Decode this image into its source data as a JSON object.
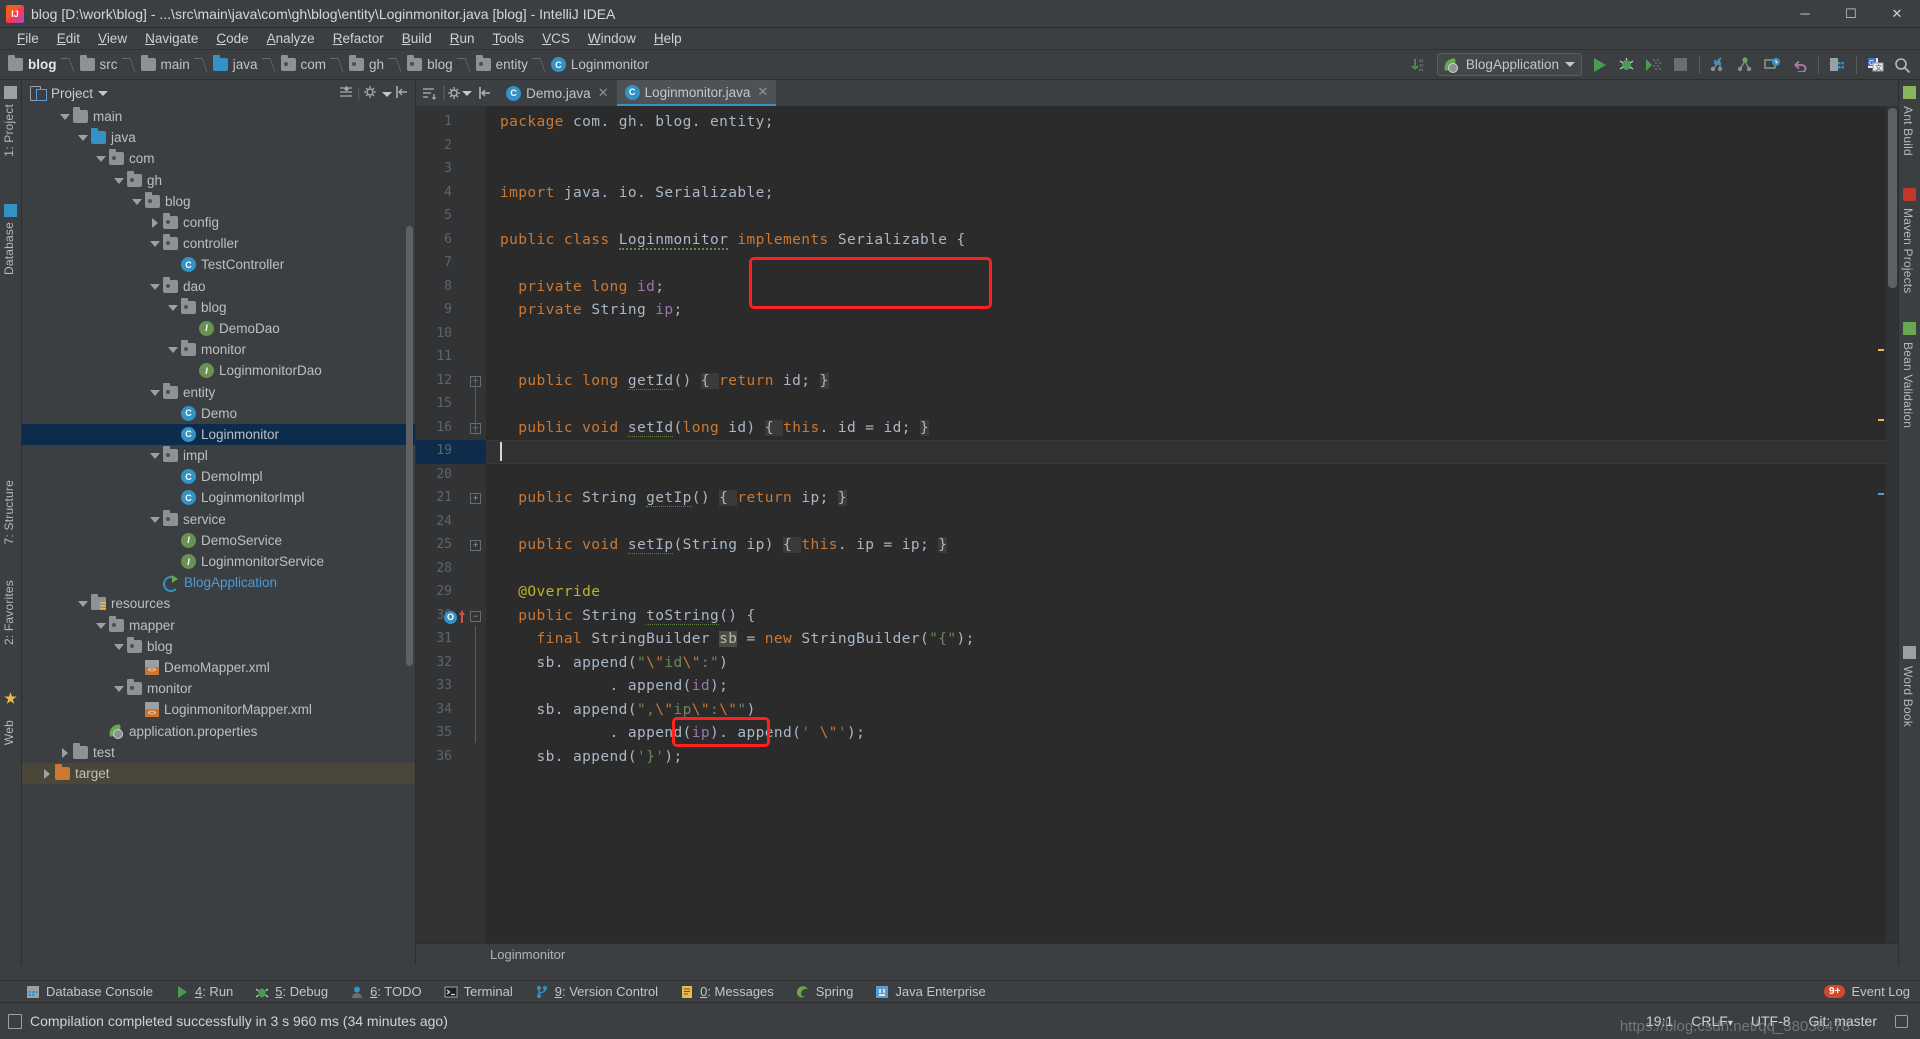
{
  "window": {
    "title": "blog [D:\\work\\blog] - ...\\src\\main\\java\\com\\gh\\blog\\entity\\Loginmonitor.java [blog] - IntelliJ IDEA",
    "app_icon": "intellij-idea-icon",
    "minimize": "─",
    "maximize": "☐",
    "close": "✕"
  },
  "menu": {
    "items": [
      "File",
      "Edit",
      "View",
      "Navigate",
      "Code",
      "Analyze",
      "Refactor",
      "Build",
      "Run",
      "Tools",
      "VCS",
      "Window",
      "Help"
    ]
  },
  "navbar": {
    "breadcrumbs": [
      {
        "label": "blog",
        "icon": "module-folder-icon"
      },
      {
        "label": "src",
        "icon": "folder-icon"
      },
      {
        "label": "main",
        "icon": "folder-icon"
      },
      {
        "label": "java",
        "icon": "source-root-folder-icon"
      },
      {
        "label": "com",
        "icon": "package-folder-icon"
      },
      {
        "label": "gh",
        "icon": "package-folder-icon"
      },
      {
        "label": "blog",
        "icon": "package-folder-icon"
      },
      {
        "label": "entity",
        "icon": "package-folder-icon"
      },
      {
        "label": "Loginmonitor",
        "icon": "java-class-icon"
      }
    ],
    "run_config": "BlogApplication",
    "toolbar_icons": [
      "download-updates-icon",
      "run-icon",
      "debug-icon",
      "run-coverage-icon",
      "stop-icon",
      "attach-icon",
      "profiler-icon",
      "db-time-icon",
      "undo-icon",
      "build-icon",
      "translate-icon",
      "search-icon"
    ]
  },
  "left_strip": {
    "tabs": [
      {
        "label": "1: Project",
        "icon": "project-tool-icon"
      },
      {
        "label": "Database",
        "icon": "database-tool-icon"
      },
      {
        "label": "7: Structure",
        "icon": "structure-tool-icon"
      },
      {
        "label": "2: Favorites",
        "icon": "favorites-tool-icon"
      },
      {
        "label": "Web",
        "icon": "web-tool-icon"
      }
    ]
  },
  "right_strip": {
    "tabs": [
      {
        "label": "Ant Build",
        "icon": "ant-icon"
      },
      {
        "label": "Maven Projects",
        "icon": "maven-icon"
      },
      {
        "label": "Bean Validation",
        "icon": "bean-icon"
      },
      {
        "label": "Word Book",
        "icon": "wordbook-icon"
      }
    ]
  },
  "project_panel": {
    "title": "Project",
    "dropdown_icon": "chevron-down-icon",
    "tools": [
      "collapse-all-icon",
      "settings-icon",
      "hide-icon"
    ],
    "tree": [
      {
        "label": "main",
        "indent": 1,
        "arrow": "down",
        "icon": "folder-icon"
      },
      {
        "label": "java",
        "indent": 2,
        "arrow": "down",
        "icon": "source-root-folder-icon"
      },
      {
        "label": "com",
        "indent": 3,
        "arrow": "down",
        "icon": "package-folder-icon"
      },
      {
        "label": "gh",
        "indent": 4,
        "arrow": "down",
        "icon": "package-folder-icon"
      },
      {
        "label": "blog",
        "indent": 5,
        "arrow": "down",
        "icon": "package-folder-icon"
      },
      {
        "label": "config",
        "indent": 6,
        "arrow": "right",
        "icon": "package-folder-icon"
      },
      {
        "label": "controller",
        "indent": 6,
        "arrow": "down",
        "icon": "package-folder-icon"
      },
      {
        "label": "TestController",
        "indent": 7,
        "arrow": "none",
        "icon": "java-class-icon"
      },
      {
        "label": "dao",
        "indent": 6,
        "arrow": "down",
        "icon": "package-folder-icon"
      },
      {
        "label": "blog",
        "indent": 7,
        "arrow": "down",
        "icon": "package-folder-icon"
      },
      {
        "label": "DemoDao",
        "indent": 8,
        "arrow": "none",
        "icon": "java-interface-icon"
      },
      {
        "label": "monitor",
        "indent": 7,
        "arrow": "down",
        "icon": "package-folder-icon"
      },
      {
        "label": "LoginmonitorDao",
        "indent": 8,
        "arrow": "none",
        "icon": "java-interface-icon"
      },
      {
        "label": "entity",
        "indent": 6,
        "arrow": "down",
        "icon": "package-folder-icon"
      },
      {
        "label": "Demo",
        "indent": 7,
        "arrow": "none",
        "icon": "java-class-icon"
      },
      {
        "label": "Loginmonitor",
        "indent": 7,
        "arrow": "none",
        "icon": "java-class-icon",
        "selected": true
      },
      {
        "label": "impl",
        "indent": 6,
        "arrow": "down",
        "icon": "package-folder-icon"
      },
      {
        "label": "DemoImpl",
        "indent": 7,
        "arrow": "none",
        "icon": "java-class-icon"
      },
      {
        "label": "LoginmonitorImpl",
        "indent": 7,
        "arrow": "none",
        "icon": "java-class-icon"
      },
      {
        "label": "service",
        "indent": 6,
        "arrow": "down",
        "icon": "package-folder-icon"
      },
      {
        "label": "DemoService",
        "indent": 7,
        "arrow": "none",
        "icon": "java-interface-icon"
      },
      {
        "label": "LoginmonitorService",
        "indent": 7,
        "arrow": "none",
        "icon": "java-interface-icon"
      },
      {
        "label": "BlogApplication",
        "indent": 6,
        "arrow": "none",
        "icon": "spring-boot-class-icon",
        "blue": true
      },
      {
        "label": "resources",
        "indent": 2,
        "arrow": "down",
        "icon": "resources-root-folder-icon"
      },
      {
        "label": "mapper",
        "indent": 3,
        "arrow": "down",
        "icon": "package-folder-icon"
      },
      {
        "label": "blog",
        "indent": 4,
        "arrow": "down",
        "icon": "package-folder-icon"
      },
      {
        "label": "DemoMapper.xml",
        "indent": 5,
        "arrow": "none",
        "icon": "xml-file-icon"
      },
      {
        "label": "monitor",
        "indent": 4,
        "arrow": "down",
        "icon": "package-folder-icon"
      },
      {
        "label": "LoginmonitorMapper.xml",
        "indent": 5,
        "arrow": "none",
        "icon": "xml-file-icon"
      },
      {
        "label": "application.properties",
        "indent": 3,
        "arrow": "none",
        "icon": "spring-properties-icon"
      },
      {
        "label": "test",
        "indent": 1,
        "arrow": "right",
        "icon": "folder-icon"
      },
      {
        "label": "target",
        "indent": 0,
        "arrow": "right",
        "icon": "excluded-folder-icon",
        "excluded": true
      }
    ]
  },
  "editor": {
    "tabs": [
      {
        "label": "Demo.java",
        "icon": "java-class-icon",
        "active": false,
        "close": "✕"
      },
      {
        "label": "Loginmonitor.java",
        "icon": "java-class-icon",
        "active": true,
        "close": "✕"
      }
    ],
    "gutter_line_numbers": [
      "1",
      "2",
      "3",
      "4",
      "5",
      "6",
      "7",
      "8",
      "9",
      "10",
      "11",
      "12",
      "15",
      "16",
      "19",
      "20",
      "21",
      "24",
      "25",
      "28",
      "29",
      "30",
      "31",
      "32",
      "33",
      "34",
      "35",
      "36"
    ],
    "current_line": "19",
    "breadcrumb": "Loginmonitor",
    "lines": [
      {
        "n": "1",
        "segments": [
          {
            "t": "package",
            "c": "kw"
          },
          {
            "t": " com. gh. blog. entity;",
            "c": "pl"
          }
        ]
      },
      {
        "n": "2",
        "segments": []
      },
      {
        "n": "3",
        "segments": []
      },
      {
        "n": "4",
        "segments": [
          {
            "t": "import",
            "c": "kw"
          },
          {
            "t": " java. io. Serializable;",
            "c": "pl"
          }
        ]
      },
      {
        "n": "5",
        "segments": []
      },
      {
        "n": "6",
        "segments": [
          {
            "t": "public class ",
            "c": "kw"
          },
          {
            "t": "Loginmonitor",
            "c": "wav"
          },
          {
            "t": " ",
            "c": "pl"
          },
          {
            "t": "implements",
            "c": "kw"
          },
          {
            "t": " Serializable",
            "c": "pl"
          },
          {
            "t": " {",
            "c": "pl"
          }
        ]
      },
      {
        "n": "7",
        "segments": []
      },
      {
        "n": "8",
        "segments": [
          {
            "t": "  private long ",
            "c": "kw"
          },
          {
            "t": "id",
            "c": "fld"
          },
          {
            "t": ";",
            "c": "pl"
          }
        ]
      },
      {
        "n": "9",
        "segments": [
          {
            "t": "  private ",
            "c": "kw"
          },
          {
            "t": "String ",
            "c": "pl"
          },
          {
            "t": "ip",
            "c": "fld"
          },
          {
            "t": ";",
            "c": "pl"
          }
        ]
      },
      {
        "n": "10",
        "segments": []
      },
      {
        "n": "11",
        "segments": []
      },
      {
        "n": "12",
        "segments": [
          {
            "t": "  public long ",
            "c": "kw"
          },
          {
            "t": "getId",
            "c": "mth"
          },
          {
            "t": "() ",
            "c": "pl"
          },
          {
            "t": "{ ",
            "c": "fldbg"
          },
          {
            "t": "return",
            "c": "kw"
          },
          {
            "t": " id; ",
            "c": "pl"
          },
          {
            "t": "}",
            "c": "fldbg"
          }
        ]
      },
      {
        "n": "15",
        "segments": []
      },
      {
        "n": "16",
        "segments": [
          {
            "t": "  public void ",
            "c": "kw"
          },
          {
            "t": "setId",
            "c": "mth"
          },
          {
            "t": "(",
            "c": "pl"
          },
          {
            "t": "long",
            "c": "kw"
          },
          {
            "t": " id) ",
            "c": "pl"
          },
          {
            "t": "{ ",
            "c": "fldbg"
          },
          {
            "t": "this",
            "c": "kw"
          },
          {
            "t": ". id = id; ",
            "c": "pl"
          },
          {
            "t": "}",
            "c": "fldbg"
          }
        ]
      },
      {
        "n": "19",
        "segments": []
      },
      {
        "n": "20",
        "segments": []
      },
      {
        "n": "21",
        "segments": [
          {
            "t": "  public ",
            "c": "kw"
          },
          {
            "t": "String ",
            "c": "pl"
          },
          {
            "t": "getIp",
            "c": "mth"
          },
          {
            "t": "() ",
            "c": "pl"
          },
          {
            "t": "{ ",
            "c": "fldbg"
          },
          {
            "t": "return",
            "c": "kw"
          },
          {
            "t": " ip; ",
            "c": "pl"
          },
          {
            "t": "}",
            "c": "fldbg"
          }
        ]
      },
      {
        "n": "24",
        "segments": []
      },
      {
        "n": "25",
        "segments": [
          {
            "t": "  public void ",
            "c": "kw"
          },
          {
            "t": "setIp",
            "c": "mth"
          },
          {
            "t": "(String ip) ",
            "c": "pl"
          },
          {
            "t": "{ ",
            "c": "fldbg"
          },
          {
            "t": "this",
            "c": "kw"
          },
          {
            "t": ". ip = ip; ",
            "c": "pl"
          },
          {
            "t": "}",
            "c": "fldbg"
          }
        ]
      },
      {
        "n": "28",
        "segments": []
      },
      {
        "n": "29",
        "segments": [
          {
            "t": "  @Override",
            "c": "anno"
          }
        ]
      },
      {
        "n": "30",
        "segments": [
          {
            "t": "  public ",
            "c": "kw"
          },
          {
            "t": "String ",
            "c": "pl"
          },
          {
            "t": "toString",
            "c": "mth"
          },
          {
            "t": "() {",
            "c": "pl"
          }
        ]
      },
      {
        "n": "31",
        "segments": [
          {
            "t": "    final ",
            "c": "kw"
          },
          {
            "t": "StringBuilder ",
            "c": "pl"
          },
          {
            "t": "sb",
            "c": "hl"
          },
          {
            "t": " = ",
            "c": "pl"
          },
          {
            "t": "new",
            "c": "kw"
          },
          {
            "t": " StringBuilder(",
            "c": "pl"
          },
          {
            "t": "\"{\"",
            "c": "str"
          },
          {
            "t": ");",
            "c": "pl"
          }
        ]
      },
      {
        "n": "32",
        "segments": [
          {
            "t": "    sb. append(",
            "c": "pl"
          },
          {
            "t": "\"",
            "c": "str"
          },
          {
            "t": "\\\"",
            "c": "esc"
          },
          {
            "t": "id",
            "c": "str"
          },
          {
            "t": "\\\"",
            "c": "esc"
          },
          {
            "t": ":\"",
            "c": "str"
          },
          {
            "t": ")",
            "c": "pl"
          }
        ]
      },
      {
        "n": "33",
        "segments": [
          {
            "t": "            . append(",
            "c": "pl"
          },
          {
            "t": "id",
            "c": "fld"
          },
          {
            "t": ");",
            "c": "pl"
          }
        ]
      },
      {
        "n": "34",
        "segments": [
          {
            "t": "    sb. append(",
            "c": "pl"
          },
          {
            "t": "\",",
            "c": "str"
          },
          {
            "t": "\\\"",
            "c": "esc"
          },
          {
            "t": "ip",
            "c": "str"
          },
          {
            "t": "\\\"",
            "c": "esc"
          },
          {
            "t": ":",
            "c": "str"
          },
          {
            "t": "\\\"",
            "c": "esc"
          },
          {
            "t": "\"",
            "c": "str"
          },
          {
            "t": ")",
            "c": "pl"
          }
        ]
      },
      {
        "n": "35",
        "segments": [
          {
            "t": "            . append(",
            "c": "pl"
          },
          {
            "t": "ip",
            "c": "fld"
          },
          {
            "t": "). append(",
            "c": "pl"
          },
          {
            "t": "' ",
            "c": "str"
          },
          {
            "t": "\\\"",
            "c": "esc"
          },
          {
            "t": "'",
            "c": "str"
          },
          {
            "t": ");",
            "c": "pl"
          }
        ]
      },
      {
        "n": "36",
        "segments": [
          {
            "t": "    sb. append(",
            "c": "pl"
          },
          {
            "t": "'}'",
            "c": "str"
          },
          {
            "t": ");",
            "c": "pl"
          }
        ]
      }
    ],
    "annotations": [
      {
        "name": "implements-serializable-highlight",
        "color": "#ff2020"
      },
      {
        "name": "tostring-method-highlight",
        "color": "#ff2020"
      }
    ]
  },
  "bottom_bar": {
    "buttons": [
      {
        "label": "Database Console",
        "icon": "database-console-icon"
      },
      {
        "label": "4: Run",
        "icon": "run-icon"
      },
      {
        "label": "5: Debug",
        "icon": "debug-icon"
      },
      {
        "label": "6: TODO",
        "icon": "todo-icon"
      },
      {
        "label": "Terminal",
        "icon": "terminal-icon"
      },
      {
        "label": "9: Version Control",
        "icon": "version-control-icon"
      },
      {
        "label": "0: Messages",
        "icon": "messages-icon"
      },
      {
        "label": "Spring",
        "icon": "spring-icon"
      },
      {
        "label": "Java Enterprise",
        "icon": "java-enterprise-icon"
      }
    ],
    "event_log": {
      "label": "Event Log",
      "badge": "9+"
    }
  },
  "status_bar": {
    "icon": "build-status-icon",
    "message": "Compilation completed successfully in 3 s 960 ms (34 minutes ago)",
    "caret_position": "19:1",
    "line_separator": "CRLF",
    "encoding": "UTF-8",
    "vcs_branch": "Git: master",
    "lock_icon": "lock-icon"
  },
  "watermark": "https://blog.csdn.net/qq_38038478",
  "colors": {
    "accent": "#3592c4",
    "panel_bg": "#3c3f41",
    "editor_bg": "#2b2b2b",
    "gutter_bg": "#313335",
    "selection": "#0d2c4b",
    "keyword": "#cc7832",
    "string": "#6a8759",
    "field": "#9876aa",
    "annotation": "#bbb529",
    "highlight_box": "#ff2020",
    "green_run": "#499c54"
  }
}
